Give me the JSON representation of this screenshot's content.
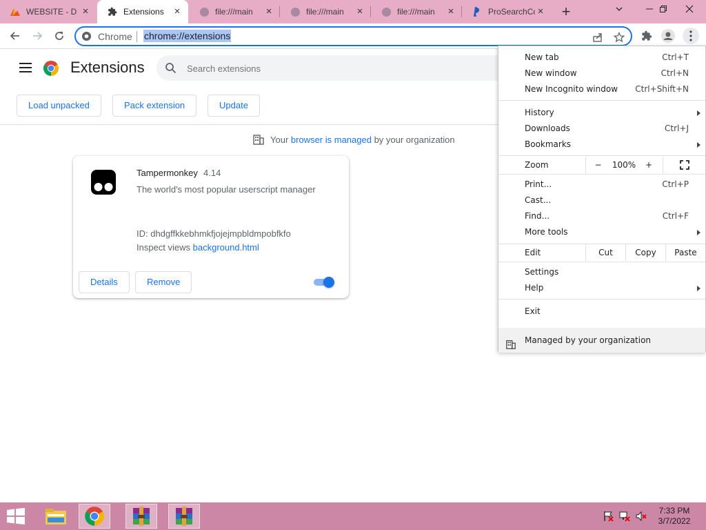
{
  "tabs": [
    {
      "title": "WEBSITE - D",
      "icon": "website-favicon"
    },
    {
      "title": "Extensions",
      "icon": "puzzle-icon",
      "active": true
    },
    {
      "title": "file:///main",
      "icon": "globe-icon"
    },
    {
      "title": "file:///main",
      "icon": "globe-icon"
    },
    {
      "title": "file:///main",
      "icon": "globe-icon"
    },
    {
      "title": "ProSearchCo",
      "icon": "prosearch-favicon"
    }
  ],
  "omnibox": {
    "site_name": "Chrome",
    "url": "chrome://extensions"
  },
  "page": {
    "title": "Extensions",
    "search_placeholder": "Search extensions",
    "buttons": {
      "load_unpacked": "Load unpacked",
      "pack_extension": "Pack extension",
      "update": "Update"
    },
    "managed_notice": {
      "prefix": "Your ",
      "link": "browser is managed",
      "suffix": " by your organization"
    }
  },
  "extension": {
    "name": "Tampermonkey",
    "version": "4.14",
    "description": "The world's most popular userscript manager",
    "id_text": "ID: dhdgffkkebhmkfjojejmpbldmpobfkfo",
    "inspect_label": "Inspect views ",
    "inspect_link": "background.html",
    "details_label": "Details",
    "remove_label": "Remove",
    "enabled": true
  },
  "menu": {
    "new_tab": {
      "label": "New tab",
      "shortcut": "Ctrl+T"
    },
    "new_window": {
      "label": "New window",
      "shortcut": "Ctrl+N"
    },
    "new_incognito": {
      "label": "New Incognito window",
      "shortcut": "Ctrl+Shift+N"
    },
    "history": {
      "label": "History"
    },
    "downloads": {
      "label": "Downloads",
      "shortcut": "Ctrl+J"
    },
    "bookmarks": {
      "label": "Bookmarks"
    },
    "zoom": {
      "label": "Zoom",
      "minus": "−",
      "value": "100%",
      "plus": "+"
    },
    "print": {
      "label": "Print...",
      "shortcut": "Ctrl+P"
    },
    "cast": {
      "label": "Cast..."
    },
    "find": {
      "label": "Find...",
      "shortcut": "Ctrl+F"
    },
    "more_tools": {
      "label": "More tools"
    },
    "edit": {
      "label": "Edit",
      "cut": "Cut",
      "copy": "Copy",
      "paste": "Paste"
    },
    "settings": {
      "label": "Settings"
    },
    "help": {
      "label": "Help"
    },
    "exit": {
      "label": "Exit"
    },
    "managed": {
      "label": "Managed by your organization"
    }
  },
  "taskbar": {
    "time": "7:33 PM",
    "date": "3/7/2022",
    "apps": [
      "file-explorer-icon",
      "chrome-icon",
      "winrar-icon",
      "winrar-icon"
    ]
  },
  "colors": {
    "tabstrip": "#e8adc6",
    "taskbar": "#cc87a7",
    "accent": "#1a73e8"
  }
}
